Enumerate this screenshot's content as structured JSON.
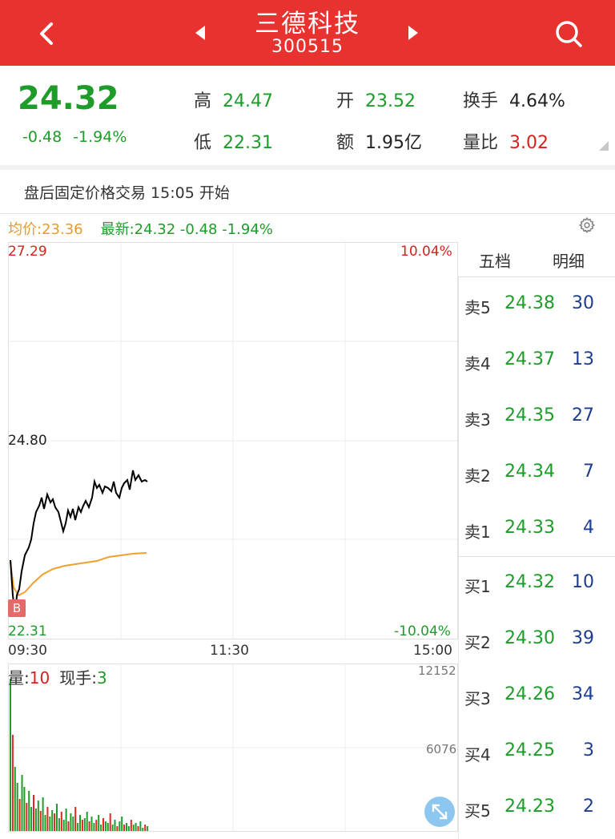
{
  "header": {
    "title": "三德科技",
    "code": "300515",
    "icons": [
      "back-icon",
      "prev-arrow-icon",
      "next-arrow-icon",
      "search-icon"
    ]
  },
  "quote": {
    "price": "24.32",
    "change": "-0.48",
    "change_pct": "-1.94%",
    "high_label": "高",
    "high": "24.47",
    "low_label": "低",
    "low": "22.31",
    "open_label": "开",
    "open": "23.52",
    "amount_label": "额",
    "amount": "1.95亿",
    "turnover_label": "换手",
    "turnover": "4.64%",
    "vol_ratio_label": "量比",
    "vol_ratio": "3.02"
  },
  "notice": "盘后固定价格交易 15:05 开始",
  "legend": {
    "avg": "均价:23.36",
    "latest": "最新:24.32 -0.48 -1.94%"
  },
  "chart": {
    "y_top": "27.29",
    "y_mid": "24.80",
    "y_bottom": "22.31",
    "pct_top": "10.04%",
    "pct_bottom": "-10.04%",
    "t_start": "09:30",
    "t_mid": "11:30",
    "t_end": "15:00",
    "marker": "B",
    "colors": {
      "price_line": "#000000",
      "avg_line": "#f0a030",
      "up": "#e0261f",
      "down": "#1e9c2a"
    }
  },
  "volume": {
    "label": "量:",
    "value": "10",
    "hand_label": "现手:",
    "hand_value": "3",
    "max": "12152",
    "mid": "6076"
  },
  "book": {
    "tab_five": "五档",
    "tab_detail": "明细",
    "sell": [
      {
        "level": "卖5",
        "price": "24.38",
        "qty": "30"
      },
      {
        "level": "卖4",
        "price": "24.37",
        "qty": "13"
      },
      {
        "level": "卖3",
        "price": "24.35",
        "qty": "27"
      },
      {
        "level": "卖2",
        "price": "24.34",
        "qty": "7"
      },
      {
        "level": "卖1",
        "price": "24.33",
        "qty": "4"
      }
    ],
    "buy": [
      {
        "level": "买1",
        "price": "24.32",
        "qty": "10"
      },
      {
        "level": "买2",
        "price": "24.30",
        "qty": "39"
      },
      {
        "level": "买3",
        "price": "24.26",
        "qty": "34"
      },
      {
        "level": "买4",
        "price": "24.25",
        "qty": "3"
      },
      {
        "level": "买5",
        "price": "24.23",
        "qty": "2"
      }
    ]
  }
}
